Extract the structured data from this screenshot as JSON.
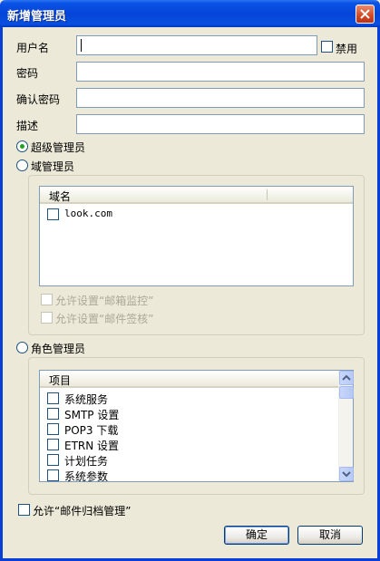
{
  "window": {
    "title": "新增管理员"
  },
  "form": {
    "username_label": "用户名",
    "username_value": "",
    "disable_label": "禁用",
    "password_label": "密码",
    "confirm_label": "确认密码",
    "description_label": "描述"
  },
  "roles": {
    "super_admin": {
      "label": "超级管理员",
      "selected": true
    },
    "domain_admin": {
      "label": "域管理员",
      "selected": false
    },
    "role_admin": {
      "label": "角色管理员",
      "selected": false
    }
  },
  "domain_group": {
    "column_header": "域名",
    "domains": [
      {
        "name": "look.com",
        "checked": false
      }
    ],
    "allow_mail_monitor": "允许设置“邮箱监控”",
    "allow_mail_signoff": "允许设置“邮件签核”"
  },
  "role_group": {
    "column_header": "项目",
    "items": [
      {
        "label": "系统服务",
        "checked": false
      },
      {
        "label": "SMTP 设置",
        "checked": false
      },
      {
        "label": "POP3 下载",
        "checked": false
      },
      {
        "label": "ETRN 设置",
        "checked": false
      },
      {
        "label": "计划任务",
        "checked": false
      },
      {
        "label": "系统参数",
        "checked": false
      }
    ]
  },
  "archive_option": {
    "label": "允许“邮件归档管理”",
    "checked": false
  },
  "buttons": {
    "ok": "确定",
    "cancel": "取消"
  },
  "colors": {
    "titlebar": "#0545d8",
    "dialog_bg": "#ece9d8",
    "selected_radio": "#21a121"
  }
}
